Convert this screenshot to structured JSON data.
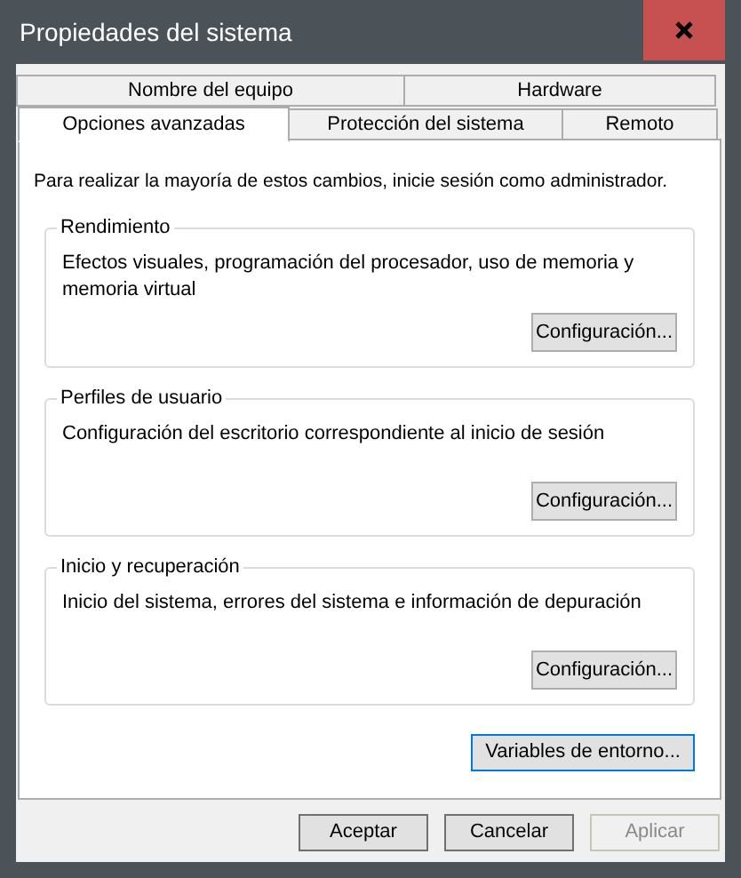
{
  "window": {
    "title": "Propiedades del sistema"
  },
  "tab_rows": [
    [
      {
        "label": "Nombre del equipo",
        "selected": false
      },
      {
        "label": "Hardware",
        "selected": false
      }
    ],
    [
      {
        "label": "Opciones avanzadas",
        "selected": true
      },
      {
        "label": "Protección del sistema",
        "selected": false
      },
      {
        "label": "Remoto",
        "selected": false
      }
    ]
  ],
  "notice": "Para realizar la mayoría de estos cambios, inicie sesión como administrador.",
  "groups": [
    {
      "title": "Rendimiento",
      "description": "Efectos visuales, programación del procesador, uso de memoria y memoria virtual",
      "button": "Configuración..."
    },
    {
      "title": "Perfiles de usuario",
      "description": "Configuración del escritorio correspondiente al inicio de sesión",
      "button": "Configuración..."
    },
    {
      "title": "Inicio y recuperación",
      "description": "Inicio del sistema, errores del sistema e información de depuración",
      "button": "Configuración..."
    }
  ],
  "environment_button": {
    "label": "Variables de entorno...",
    "focused": true
  },
  "footer_buttons": [
    {
      "label": "Aceptar",
      "disabled": false
    },
    {
      "label": "Cancelar",
      "disabled": false
    },
    {
      "label": "Aplicar",
      "disabled": true
    }
  ]
}
